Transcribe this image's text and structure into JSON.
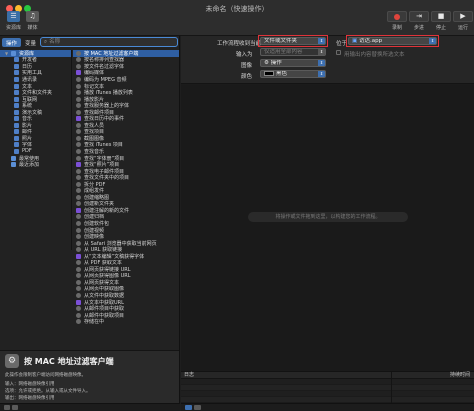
{
  "window": {
    "title": "未命名（快速操作）"
  },
  "toolbar": {
    "library_label": "资源库",
    "media_label": "媒体",
    "record_label": "录制",
    "step_label": "步进",
    "stop_label": "停止",
    "run_label": "运行"
  },
  "left": {
    "tabs": [
      "操作",
      "变量"
    ],
    "search_placeholder": "名称",
    "categories": [
      {
        "label": "资源库",
        "level": 0,
        "selected": true
      },
      {
        "label": "开发者",
        "level": 1
      },
      {
        "label": "日历",
        "level": 1
      },
      {
        "label": "实用工具",
        "level": 1
      },
      {
        "label": "通讯录",
        "level": 1
      },
      {
        "label": "文本",
        "level": 1
      },
      {
        "label": "文件和文件夹",
        "level": 1
      },
      {
        "label": "互联网",
        "level": 1
      },
      {
        "label": "系统",
        "level": 1
      },
      {
        "label": "演示文稿",
        "level": 1
      },
      {
        "label": "音乐",
        "level": 1
      },
      {
        "label": "影片",
        "level": 1
      },
      {
        "label": "邮件",
        "level": 1
      },
      {
        "label": "照片",
        "level": 1
      },
      {
        "label": "字体",
        "level": 1
      },
      {
        "label": "PDF",
        "level": 1
      },
      {
        "label": "最常使用",
        "level": 0
      },
      {
        "label": "最近添加",
        "level": 0
      }
    ],
    "actions": [
      {
        "label": "按 MAC 地址过滤客户端",
        "selected": true
      },
      {
        "label": "按名称排列查找器"
      },
      {
        "label": "按文件名过滤字体"
      },
      {
        "label": "编码媒体"
      },
      {
        "label": "编码为 MPEG 音频"
      },
      {
        "label": "标记文本"
      },
      {
        "label": "播放 iTunes 播放列表"
      },
      {
        "label": "播放影片"
      },
      {
        "label": "查找服务器上的字体"
      },
      {
        "label": "查找邮件项目"
      },
      {
        "label": "查找日历中的事件"
      },
      {
        "label": "查找人员"
      },
      {
        "label": "查找项目"
      },
      {
        "label": "截图图像"
      },
      {
        "label": "查找 iTunes 项目"
      },
      {
        "label": "查找音乐"
      },
      {
        "label": "查找“字体册”项目"
      },
      {
        "label": "查找“照片”项目"
      },
      {
        "label": "查找电子邮件项目"
      },
      {
        "label": "查找文件夹中的项目"
      },
      {
        "label": "拆分 PDF"
      },
      {
        "label": "成组发件"
      },
      {
        "label": "创建缩略图"
      },
      {
        "label": "创建新文件夹"
      },
      {
        "label": "创建注解的新的文件"
      },
      {
        "label": "创建归档"
      },
      {
        "label": "创建软件包"
      },
      {
        "label": "创建视频"
      },
      {
        "label": "创建映像"
      },
      {
        "label": "从 Safari 浏览器中获取当前网页"
      },
      {
        "label": "从 URL 获取链接"
      },
      {
        "label": "从“文本编辑”文稿获得字体"
      },
      {
        "label": "从 PDF 获取文本"
      },
      {
        "label": "从网页获得链接 URL"
      },
      {
        "label": "从网页获得图像 URL"
      },
      {
        "label": "从网页获得文本"
      },
      {
        "label": "从网页中获取图像"
      },
      {
        "label": "从文件中获取数据"
      },
      {
        "label": "从文本中获取URL"
      },
      {
        "label": "从邮件项目中获取"
      },
      {
        "label": "从邮件中获取项目"
      },
      {
        "label": "存储在中"
      }
    ],
    "description": {
      "title": "按 MAC 地址过滤客户端",
      "lines": [
        "此操作会限制客户端访问网络磁盘映像。",
        "输入：网络磁盘映像引用",
        "选项：允许或拒绝。从输入或从文件导入。",
        "输出：网络磁盘映像引用"
      ]
    }
  },
  "workflow": {
    "receives_label": "工作流程收到当前",
    "receives_value": "文件或文件夹",
    "in_label": "位于",
    "in_value": "访达.app",
    "input_is_label": "输入为",
    "input_is_value": "仅适用全部内容",
    "replace_label": "用输出内容替换所选文本",
    "image_label": "图像",
    "image_value": "操作",
    "color_label": "颜色",
    "color_value": "黑色",
    "drop_hint": "将操作或文件拖到这里，以构建您的工作流程。"
  },
  "log": {
    "col_log": "日志",
    "col_duration": "持续时间"
  },
  "colors": {
    "accent": "#3d6fb0",
    "highlight_border": "#e0333a",
    "record": "#e0443c"
  }
}
